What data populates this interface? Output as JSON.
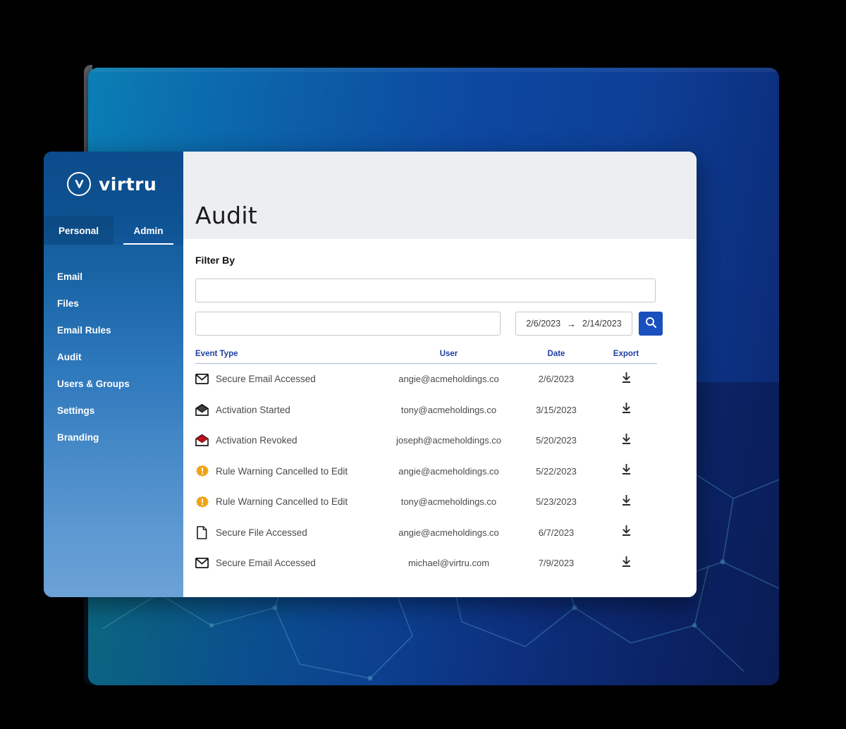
{
  "brand": {
    "logo_icon": "virtru-circle-v-icon",
    "wordmark": "virtru",
    "accent_blue": "#1a4fbe",
    "sidebar_top": "#0d4f8f",
    "sidebar_bottom": "#6ba2d6",
    "header_text": "#1f3fa0"
  },
  "sidebar": {
    "tabs": [
      {
        "label": "Personal",
        "active": false
      },
      {
        "label": "Admin",
        "active": true
      }
    ],
    "items": [
      {
        "label": "Email"
      },
      {
        "label": "Files"
      },
      {
        "label": "Email Rules"
      },
      {
        "label": "Audit"
      },
      {
        "label": "Users & Groups"
      },
      {
        "label": "Settings"
      },
      {
        "label": "Branding"
      }
    ]
  },
  "header": {
    "title": "Audit"
  },
  "filter": {
    "label": "Filter By",
    "input_primary": {
      "value": "",
      "placeholder": ""
    },
    "input_secondary": {
      "value": "",
      "placeholder": ""
    },
    "date_range": {
      "start": "2/6/2023",
      "arrow": "→",
      "end": "2/14/2023"
    },
    "search_icon": "search-icon"
  },
  "table": {
    "columns": [
      "Event Type",
      "User",
      "Date",
      "Export"
    ],
    "export_icon": "download-icon",
    "rows": [
      {
        "icon": "closed-envelope-icon",
        "event": "Secure Email Accessed",
        "user": "angie@acmeholdings.co",
        "date": "2/6/2023"
      },
      {
        "icon": "open-envelope-dark-icon",
        "event": "Activation Started",
        "user": "tony@acmeholdings.co",
        "date": "3/15/2023"
      },
      {
        "icon": "open-envelope-red-icon",
        "event": "Activation Revoked",
        "user": "joseph@acmeholdings.co",
        "date": "5/20/2023"
      },
      {
        "icon": "warning-badge-icon",
        "event": "Rule Warning Cancelled to Edit",
        "user": "angie@acmeholdings.co",
        "date": "5/22/2023"
      },
      {
        "icon": "warning-badge-icon",
        "event": "Rule Warning Cancelled to Edit",
        "user": "tony@acmeholdings.co",
        "date": "5/23/2023"
      },
      {
        "icon": "document-icon",
        "event": "Secure File Accessed",
        "user": "angie@acmeholdings.co",
        "date": "6/7/2023"
      },
      {
        "icon": "closed-envelope-icon",
        "event": "Secure Email Accessed",
        "user": "michael@virtru.com",
        "date": "7/9/2023"
      }
    ]
  }
}
